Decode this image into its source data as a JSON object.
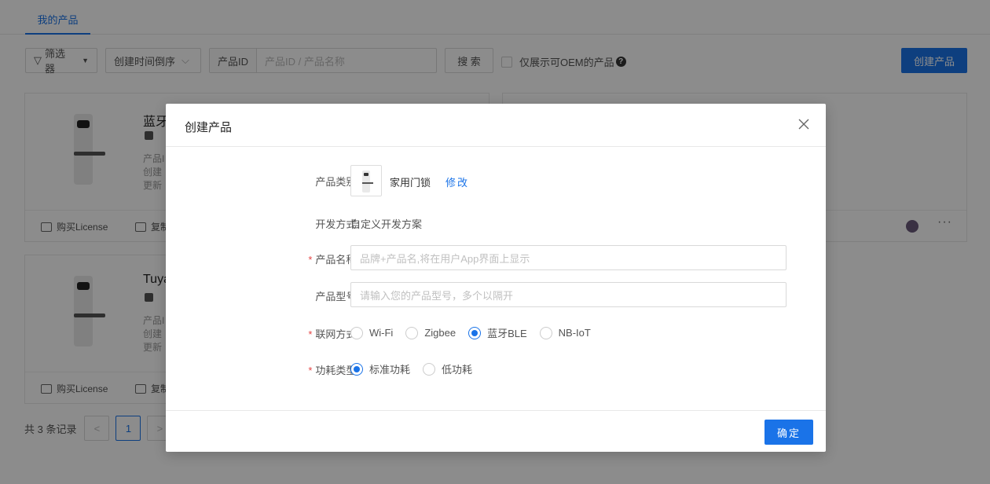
{
  "tabs": {
    "active": "我的产品"
  },
  "toolbar": {
    "filter_label": "筛选器",
    "sort_label": "创建时间倒序",
    "search_prefix": "产品ID",
    "search_placeholder": "产品ID / 产品名称",
    "search_button": "搜 索",
    "oem_checkbox_label": "仅展示可OEM的产品",
    "create_button": "创建产品"
  },
  "cards": [
    {
      "title": "蓝牙",
      "meta_lines": [
        "产品I",
        "创建",
        "更新"
      ],
      "buy_label": "购买License",
      "copy_label": "复制"
    },
    {
      "title": "Tuya",
      "meta_lines": [
        "产品I",
        "创建",
        "更新"
      ],
      "buy_label": "购买License",
      "copy_label": "复制"
    }
  ],
  "pager": {
    "total_text": "共 3 条记录",
    "prev": "<",
    "current": "1",
    "next": ">"
  },
  "modal": {
    "title": "创建产品",
    "category_label": "产品类别:",
    "category_value": "家用门锁",
    "category_modify": "修改",
    "dev_method_label": "开发方式:",
    "dev_method_value": "自定义开发方案",
    "product_name_label": "产品名称:",
    "product_name_placeholder": "品牌+产品名,将在用户App界面上显示",
    "product_model_label": "产品型号:",
    "product_model_placeholder": "请输入您的产品型号，多个以隔开",
    "network_label": "联网方式:",
    "network_options": [
      "Wi-Fi",
      "Zigbee",
      "蓝牙BLE",
      "NB-IoT"
    ],
    "network_selected": "蓝牙BLE",
    "power_label": "功耗类型:",
    "power_options": [
      "标准功耗",
      "低功耗"
    ],
    "power_selected": "标准功耗",
    "confirm_button": "确定",
    "required_mark": "*"
  },
  "colors": {
    "primary": "#1a73e8",
    "required": "#e54545"
  }
}
